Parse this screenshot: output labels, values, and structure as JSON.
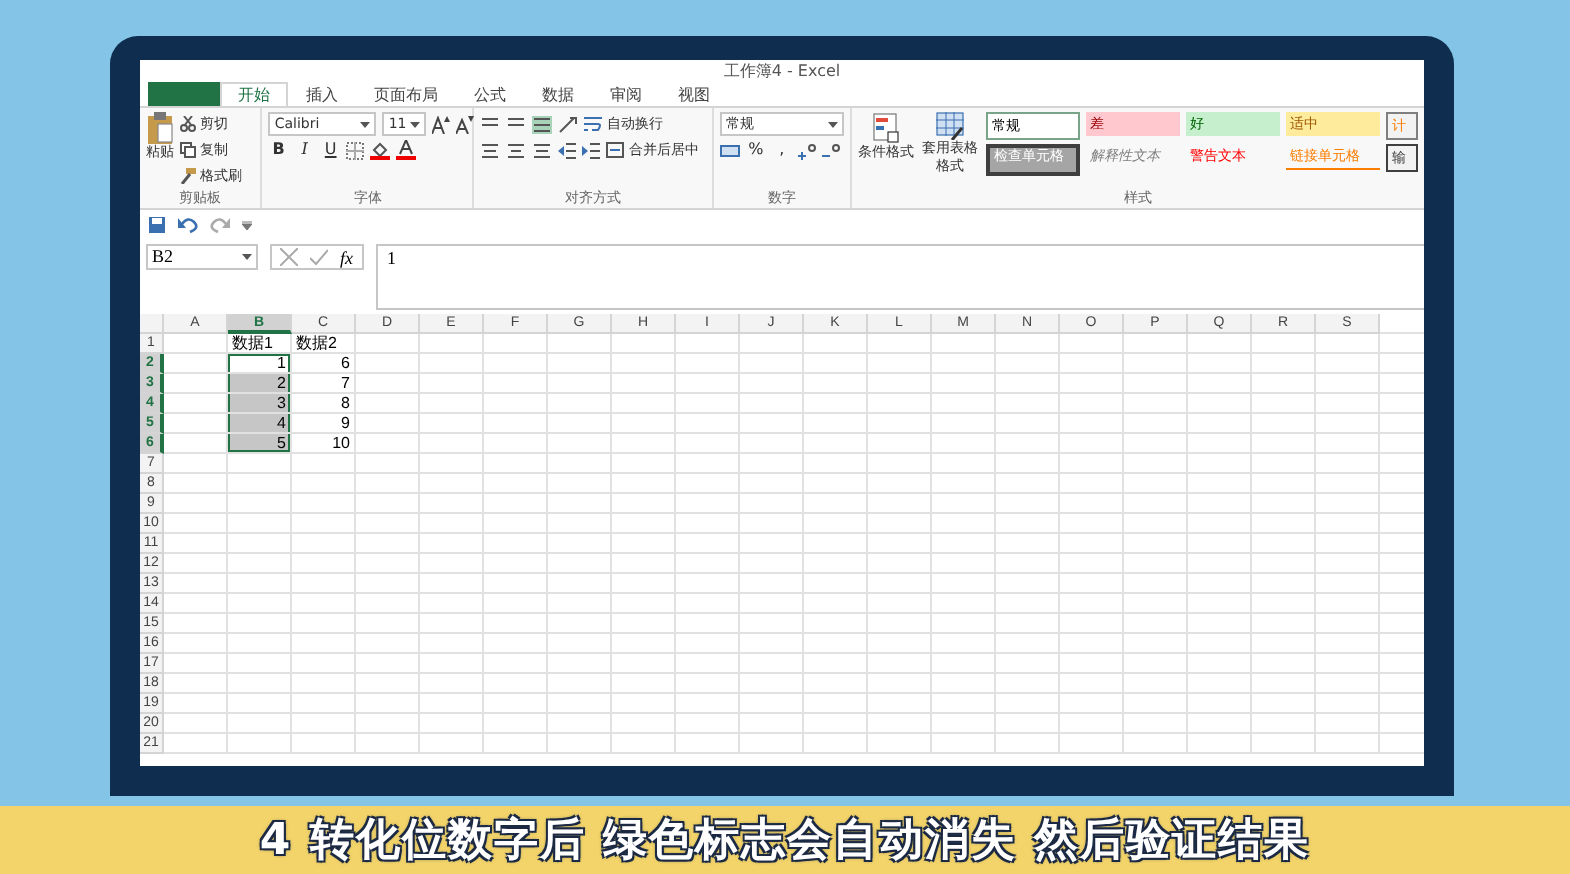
{
  "window": {
    "title": "工作簿4 - Excel"
  },
  "tabs": [
    {
      "label": "开始",
      "selected": true
    },
    {
      "label": "插入",
      "selected": false
    },
    {
      "label": "页面布局",
      "selected": false
    },
    {
      "label": "公式",
      "selected": false
    },
    {
      "label": "数据",
      "selected": false
    },
    {
      "label": "审阅",
      "selected": false
    },
    {
      "label": "视图",
      "selected": false
    }
  ],
  "ribbon": {
    "clipboard": {
      "label": "剪贴板",
      "paste": "粘贴",
      "cut": "剪切",
      "copy": "复制",
      "format_painter": "格式刷"
    },
    "font": {
      "label": "字体",
      "font_name": "Calibri",
      "font_size": "11",
      "bold": "B",
      "italic": "I",
      "underline": "U"
    },
    "alignment": {
      "label": "对齐方式",
      "wrap_text": "自动换行",
      "merge_center": "合并后居中"
    },
    "number": {
      "label": "数字",
      "format": "常规",
      "percent": "%",
      "comma": ","
    },
    "styles": {
      "label": "样式",
      "conditional_formatting": "条件格式",
      "format_as_table": "套用表格格式",
      "cell_styles": [
        {
          "text": "常规",
          "kind": "normal"
        },
        {
          "text": "差",
          "kind": "bad"
        },
        {
          "text": "好",
          "kind": "good"
        },
        {
          "text": "适中",
          "kind": "neutral"
        },
        {
          "text": "计",
          "kind": "calc"
        },
        {
          "text": "检查单元格",
          "kind": "check"
        },
        {
          "text": "解释性文本",
          "kind": "explanatory"
        },
        {
          "text": "警告文本",
          "kind": "warning"
        },
        {
          "text": "链接单元格",
          "kind": "linked"
        },
        {
          "text": "输",
          "kind": "output"
        }
      ]
    }
  },
  "formula_bar": {
    "name_box": "B2",
    "function_label": "fx",
    "value": "1"
  },
  "grid": {
    "columns": [
      {
        "label": "A",
        "selected": false
      },
      {
        "label": "B",
        "selected": true
      },
      {
        "label": "C",
        "selected": false
      },
      {
        "label": "D",
        "selected": false
      },
      {
        "label": "E",
        "selected": false
      },
      {
        "label": "F",
        "selected": false
      },
      {
        "label": "G",
        "selected": false
      },
      {
        "label": "H",
        "selected": false
      },
      {
        "label": "I",
        "selected": false
      },
      {
        "label": "J",
        "selected": false
      },
      {
        "label": "K",
        "selected": false
      },
      {
        "label": "L",
        "selected": false
      },
      {
        "label": "M",
        "selected": false
      },
      {
        "label": "N",
        "selected": false
      },
      {
        "label": "O",
        "selected": false
      },
      {
        "label": "P",
        "selected": false
      },
      {
        "label": "Q",
        "selected": false
      },
      {
        "label": "R",
        "selected": false
      },
      {
        "label": "S",
        "selected": false
      }
    ],
    "rows": [
      {
        "label": "1",
        "selected": false,
        "B": {
          "text": "数据1",
          "selected": false,
          "active": false
        },
        "C": {
          "text": "数据2",
          "selected": false,
          "active": false
        }
      },
      {
        "label": "2",
        "selected": true,
        "B": {
          "text": "1",
          "selected": true,
          "active": true
        },
        "C": {
          "text": "6",
          "selected": false,
          "active": false
        }
      },
      {
        "label": "3",
        "selected": true,
        "B": {
          "text": "2",
          "selected": true,
          "active": false
        },
        "C": {
          "text": "7",
          "selected": false,
          "active": false
        }
      },
      {
        "label": "4",
        "selected": true,
        "B": {
          "text": "3",
          "selected": true,
          "active": false
        },
        "C": {
          "text": "8",
          "selected": false,
          "active": false
        }
      },
      {
        "label": "5",
        "selected": true,
        "B": {
          "text": "4",
          "selected": true,
          "active": false
        },
        "C": {
          "text": "9",
          "selected": false,
          "active": false
        }
      },
      {
        "label": "6",
        "selected": true,
        "B": {
          "text": "5",
          "selected": true,
          "active": false
        },
        "C": {
          "text": "10",
          "selected": false,
          "active": false
        }
      },
      {
        "label": "7",
        "selected": false
      },
      {
        "label": "8",
        "selected": false
      },
      {
        "label": "9",
        "selected": false
      },
      {
        "label": "10",
        "selected": false
      },
      {
        "label": "11",
        "selected": false
      },
      {
        "label": "12",
        "selected": false
      },
      {
        "label": "13",
        "selected": false
      },
      {
        "label": "14",
        "selected": false
      },
      {
        "label": "15",
        "selected": false
      },
      {
        "label": "16",
        "selected": false
      },
      {
        "label": "17",
        "selected": false
      },
      {
        "label": "18",
        "selected": false
      },
      {
        "label": "19",
        "selected": false
      },
      {
        "label": "20",
        "selected": false
      },
      {
        "label": "21",
        "selected": false
      }
    ]
  },
  "caption": {
    "text": "4 转化位数字后 绿色标志会自动消失 然后验证结果"
  }
}
